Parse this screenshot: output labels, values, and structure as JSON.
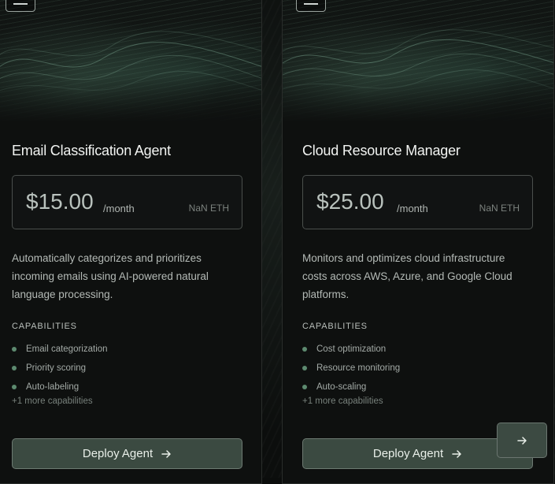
{
  "agents": [
    {
      "title": "Email Classification Agent",
      "price": "$15.00",
      "period": "/month",
      "eth": "NaN ETH",
      "description": "Automatically categorizes and prioritizes incoming emails using AI-powered natural language processing.",
      "capabilities_heading": "CAPABILITIES",
      "capabilities": [
        "Email categorization",
        "Priority scoring",
        "Auto-labeling"
      ],
      "more_capabilities": "+1 more capabilities",
      "deploy_label": "Deploy Agent"
    },
    {
      "title": "Cloud Resource Manager",
      "price": "$25.00",
      "period": "/month",
      "eth": "NaN ETH",
      "description": "Monitors and optimizes cloud infrastructure costs across AWS, Azure, and Google Cloud platforms.",
      "capabilities_heading": "CAPABILITIES",
      "capabilities": [
        "Cost optimization",
        "Resource monitoring",
        "Auto-scaling"
      ],
      "more_capabilities": "+1 more capabilities",
      "deploy_label": "Deploy Agent"
    }
  ],
  "icons": {
    "card_logo": "logo-box-icon",
    "deploy_arrow": "arrow-right-icon",
    "next": "arrow-right-icon"
  },
  "colors": {
    "accent_dot": "#5d8a6f",
    "button_bg": "#3b4a41",
    "price_text": "#b9c2bd"
  }
}
